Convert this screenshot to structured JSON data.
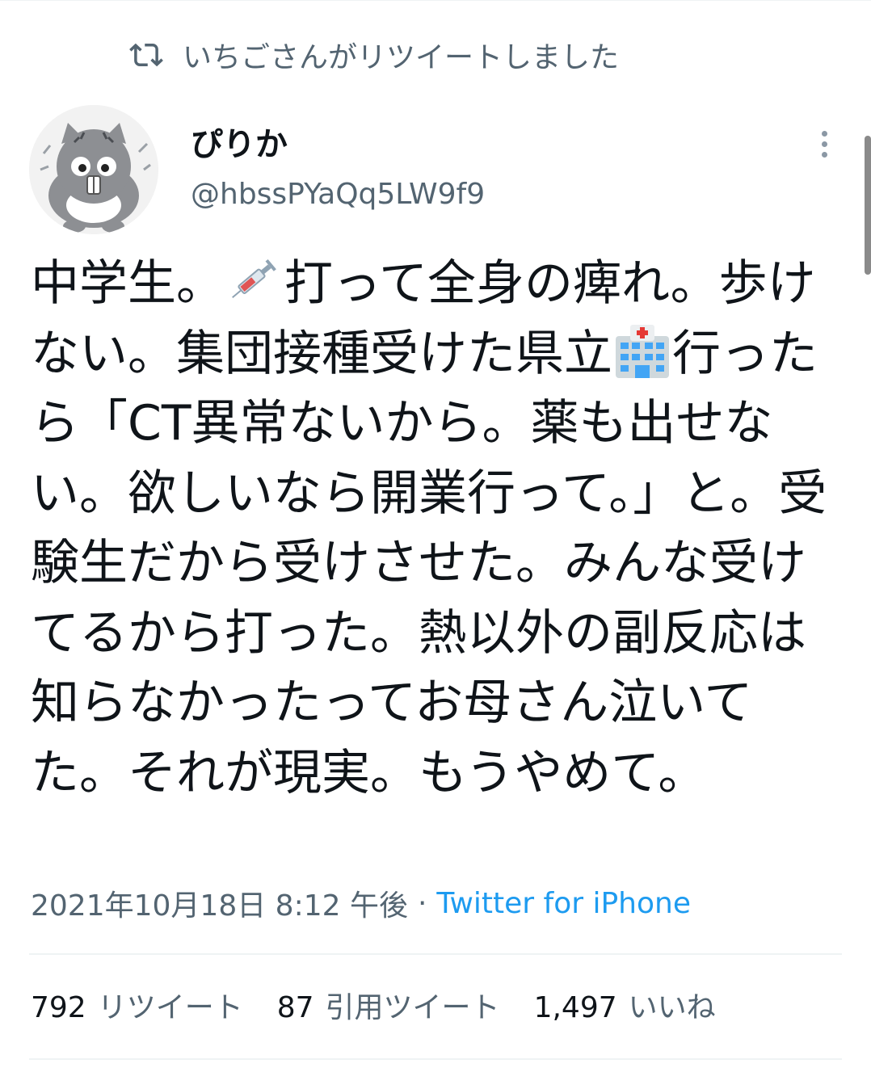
{
  "retweet_context": {
    "icon": "retweet-icon",
    "text": "いちごさんがリツイートしました"
  },
  "author": {
    "avatar": "avatar-cat-illustration",
    "display_name": "ぴりか",
    "handle": "@hbssPYaQq5LW9f9"
  },
  "tweet": {
    "text_parts": {
      "p1": "中学生。",
      "emoji1": "💉",
      "p2": "打って全身の痺れ。歩けない。集団接種受けた県立",
      "emoji2": "🏥",
      "p3": "行ったら「CT異常ないから。薬も出せない。欲しいなら開業行って。」と。受験生だから受けさせた。みんな受けてるから打った。熱以外の副反応は知らなかったってお母さん泣いてた。それが現実。もうやめて。"
    }
  },
  "meta": {
    "timestamp": "2021年10月18日 8:12 午後",
    "separator": "·",
    "source": "Twitter for iPhone"
  },
  "stats": {
    "retweets_count": "792",
    "retweets_label": "リツイート",
    "quotes_count": "87",
    "quotes_label": "引用ツイート",
    "likes_count": "1,497",
    "likes_label": "いいね"
  },
  "colors": {
    "secondary_text": "#536471",
    "link": "#1d9bf0",
    "primary_text": "#0f1419"
  }
}
